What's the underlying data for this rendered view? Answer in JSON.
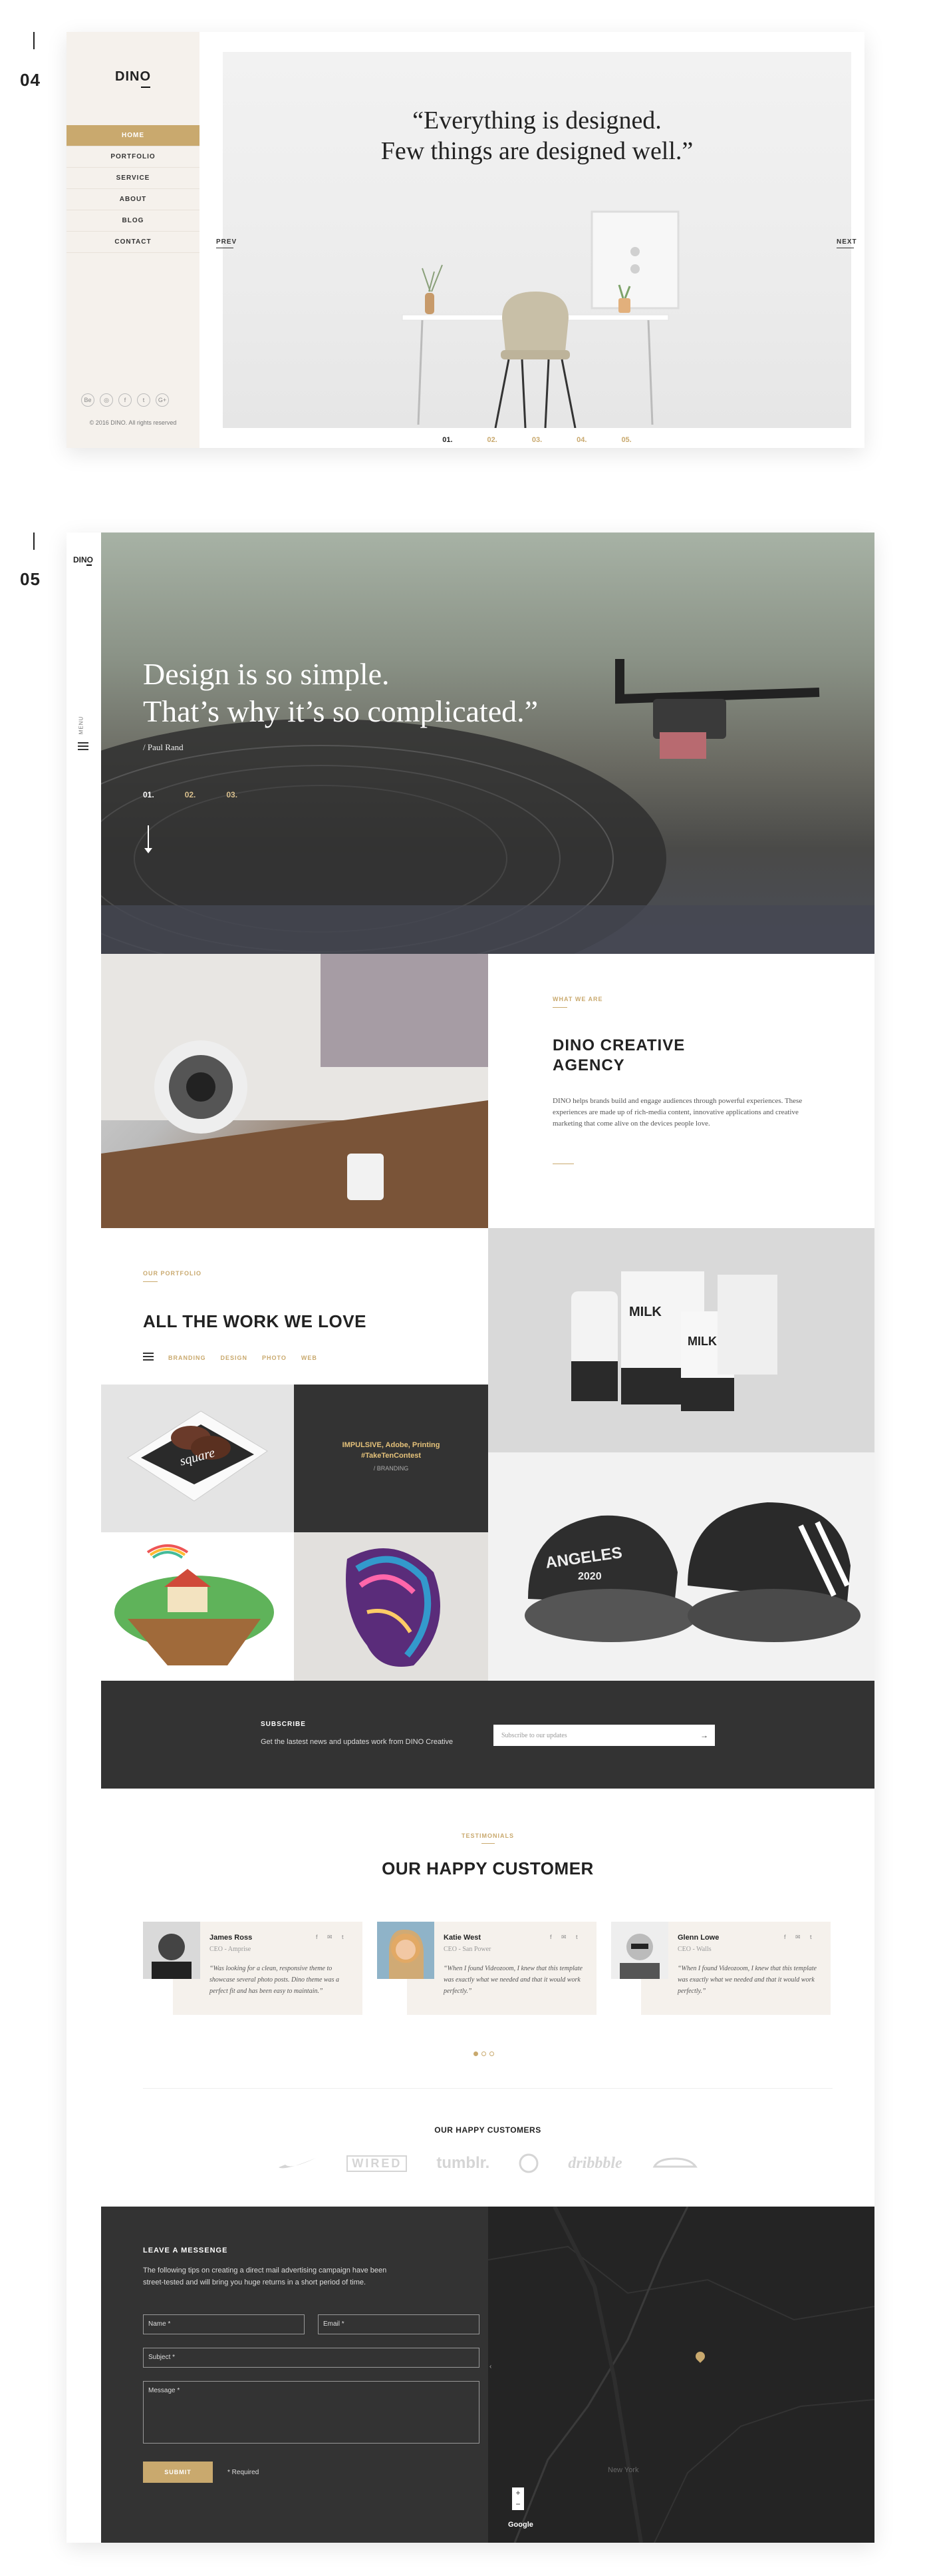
{
  "sections": [
    "04",
    "05"
  ],
  "frame04": {
    "logo": "DINO",
    "nav": [
      "HOME",
      "PORTFOLIO",
      "SERVICE",
      "ABOUT",
      "BLOG",
      "CONTACT"
    ],
    "socials": [
      "Be",
      "◎",
      "f",
      "t",
      "G+"
    ],
    "copyright": "© 2016 DINO.  All rights reserved",
    "quote_line1": "“Everything is designed.",
    "quote_line2": "Few things are designed well.”",
    "prev": "PREV",
    "next": "NEXT",
    "pager": [
      "01.",
      "02.",
      "03.",
      "04.",
      "05."
    ]
  },
  "frame05": {
    "rail_logo": "DINO",
    "rail_menu": "MENU",
    "hero": {
      "line1": "Design is so simple.",
      "line2": "That’s why it’s so complicated.”",
      "author": "/ Paul Rand",
      "dots": [
        "01.",
        "02.",
        "03."
      ]
    },
    "about": {
      "label": "WHAT WE ARE",
      "title_line1": "DINO CREATIVE",
      "title_line2": "AGENCY",
      "text": "DINO helps brands build and engage audiences through powerful experiences. These experiences are made up of rich-media content, innovative applications and creative marketing that come alive on the devices people love."
    },
    "work": {
      "label": "OUR PORTFOLIO",
      "title": "ALL THE WORK WE LOVE",
      "filters": [
        "BRANDING",
        "DESIGN",
        "PHOTO",
        "WEB"
      ],
      "tile_square": "square",
      "tile_hover_title": "IMPULSIVE, Adobe, Printing",
      "tile_hover_tag": "#TakeTenContest",
      "tile_hover_cat": "/ BRANDING",
      "milk": "MILK",
      "cap_text": "ANGELES",
      "cap_year": "2020"
    },
    "subscribe": {
      "title": "SUBSCRIBE",
      "text": "Get the lastest news and updates work from DINO Creative",
      "placeholder": "Subscribe to our updates",
      "arrow": "→"
    },
    "testimonials": {
      "label": "TESTIMONIALS",
      "title": "OUR HAPPY CUSTOMER",
      "people": [
        {
          "name": "James Ross",
          "role": "CEO - Amprise",
          "quote": "“Was looking for a clean, responsive theme to showcase several photo posts. Dino theme was a perfect fit and has been easy to maintain.”"
        },
        {
          "name": "Katie West",
          "role": "CEO - San Power",
          "quote": "“When I found Videozoom, I knew that this template was exactly what we needed and that it would work perfectly.”"
        },
        {
          "name": "Glenn Lowe",
          "role": "CEO - Walls",
          "quote": "“When I found Videozoom, I knew that this template was exactly what we needed and that it would work perfectly.”"
        }
      ],
      "social_icons": "f ✉ t",
      "customers_title": "OUR HAPPY CUSTOMERS",
      "logos": [
        "WIRED",
        "tumblr.",
        "dribbble"
      ]
    },
    "contact": {
      "title": "LEAVE A MESSENGE",
      "text": "The following tips on creating a direct mail advertising campaign have been street-tested and will bring you huge returns in a short period of time.",
      "name": "Name *",
      "email": "Email *",
      "subject": "Subject *",
      "message": "Message *",
      "submit": "SUBMIT",
      "required": "* Required",
      "map_city": "New York",
      "google": "Google"
    }
  },
  "colors": {
    "accent": "#c9a96e",
    "dark": "#333333",
    "cream": "#f5f1ec"
  }
}
